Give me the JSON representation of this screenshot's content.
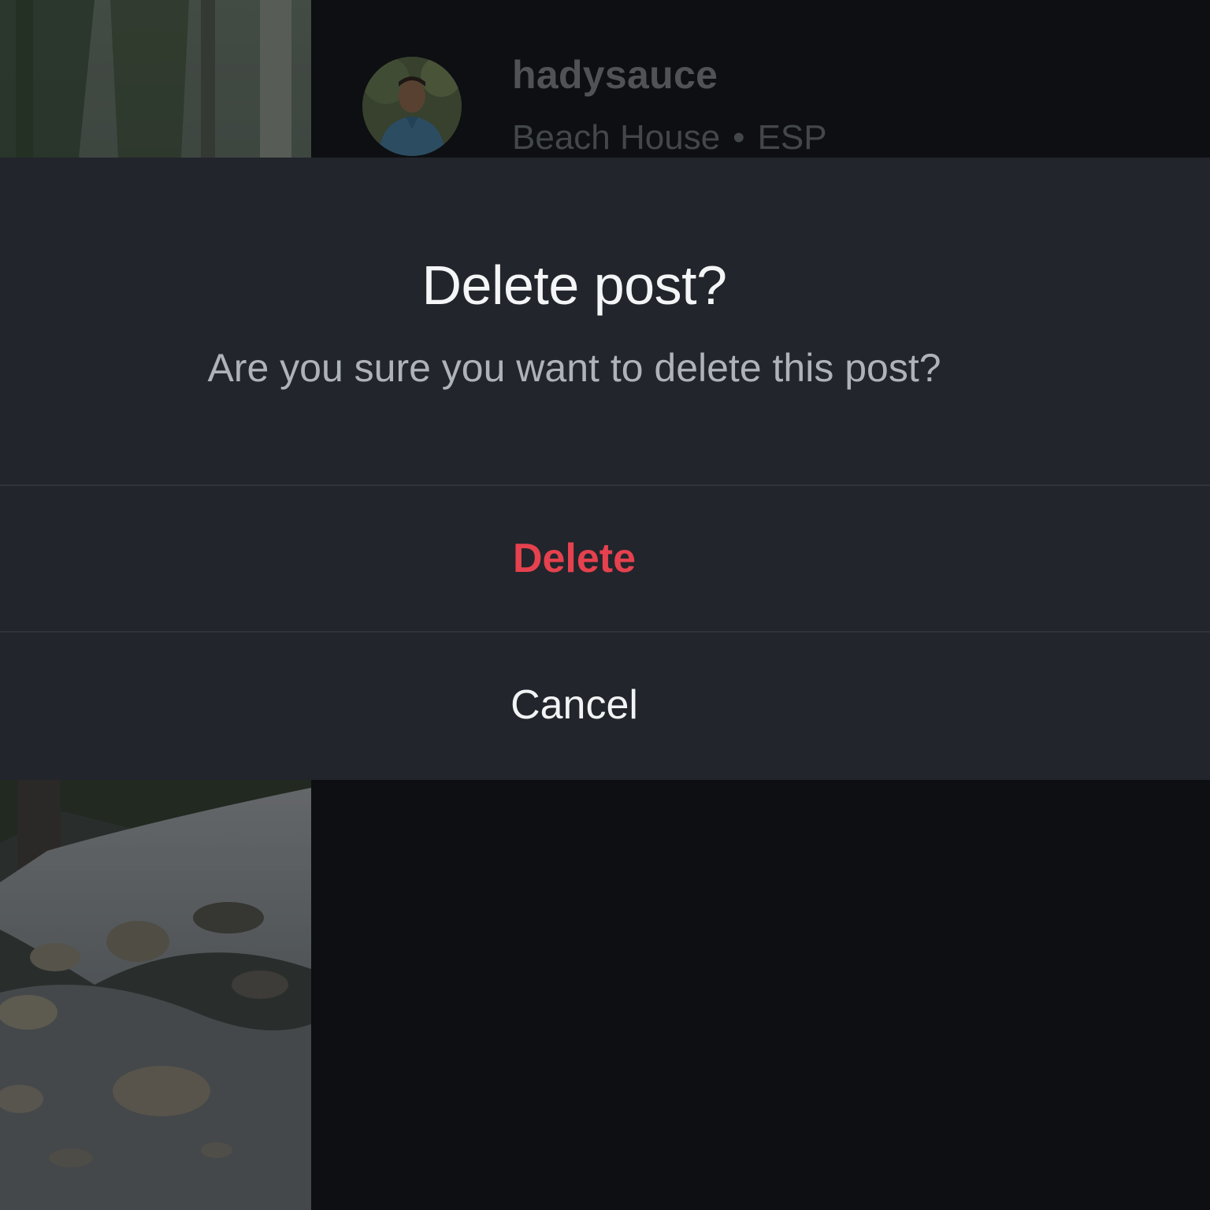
{
  "post": {
    "username": "hadysauce",
    "location": "Beach House",
    "separator": "•",
    "country": "ESP"
  },
  "dialog": {
    "title": "Delete post?",
    "message": "Are you sure you want to delete this post?",
    "delete_label": "Delete",
    "cancel_label": "Cancel"
  },
  "colors": {
    "background": "#121519",
    "dialog_background": "#22252b",
    "destructive": "#e5414e",
    "primary_text": "#f4f5f6",
    "secondary_text": "#aeb3b9"
  }
}
